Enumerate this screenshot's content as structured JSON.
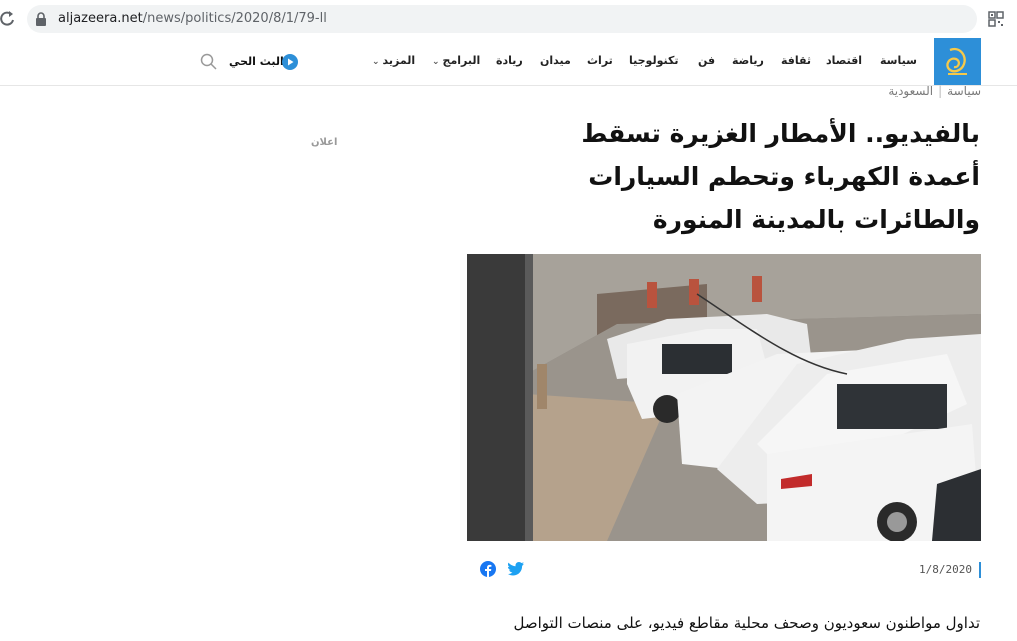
{
  "browser": {
    "url_domain": "aljazeera.net",
    "url_path": "/news/politics/2020/8/1/79-ll"
  },
  "nav": {
    "items": [
      "سياسة",
      "اقتصاد",
      "ثقافة",
      "رياضة",
      "فن",
      "تكنولوجيا",
      "تراث",
      "ميدان",
      "ريادة",
      "البرامج",
      "المزيد"
    ],
    "live_label": "البث الحي"
  },
  "breadcrumb": {
    "section": "سياسة",
    "country": "السعودية"
  },
  "ad_label": "اعلان",
  "article": {
    "headline": "بالفيديو.. الأمطار الغزيرة تسقط أعمدة الكهرباء وتحطم السيارات والطائرات بالمدينة المنورة",
    "date": "1/8/2020",
    "body_start": "تداول مواطنون سعوديون وصحف محلية مقاطع فيديو، على منصات التواصل"
  },
  "colors": {
    "brand_blue": "#2d8fd8"
  }
}
